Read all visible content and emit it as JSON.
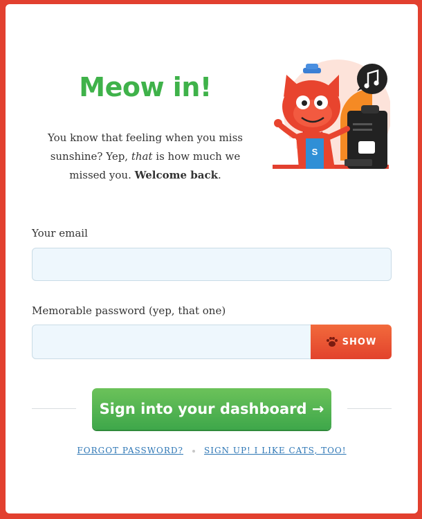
{
  "login": {
    "title": "Meow in!",
    "intro_part1": "You know that feeling when you miss sunshine? Yep, ",
    "intro_emphasis": "that",
    "intro_part2": " is how much we missed you. ",
    "intro_bold": "Welcome back",
    "intro_end": ".",
    "email_label": "Your email",
    "email_value": "",
    "email_placeholder": "",
    "password_label": "Memorable password (yep, that one)",
    "password_value": "",
    "password_placeholder": "",
    "show_label": "SHOW",
    "submit_label": "Sign into your dashboard →",
    "forgot_label": "FORGOT PASSWORD?",
    "signup_label": "SIGN UP! I LIKE CATS, TOO!"
  },
  "illustration": {
    "icon": "cat-barista-illustration",
    "badge_letter": "S"
  },
  "colors": {
    "frame": "#e2402f",
    "brand_green": "#3fb24a",
    "input_bg": "#eef7fd",
    "show_button": "#e94a2f",
    "link": "#2d76b5"
  }
}
